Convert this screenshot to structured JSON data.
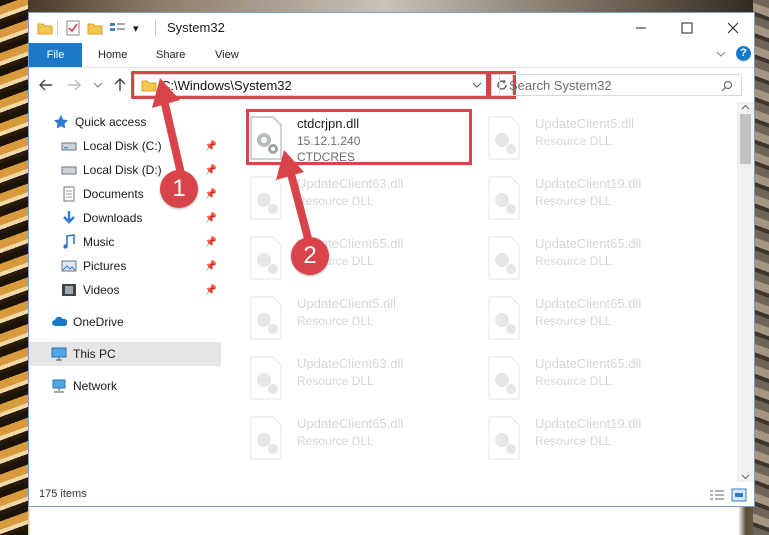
{
  "window": {
    "title": "System32",
    "qa_dropdown": "▾"
  },
  "ribbon": {
    "tabs": [
      {
        "label": "File"
      },
      {
        "label": "Home"
      },
      {
        "label": "Share"
      },
      {
        "label": "View"
      }
    ],
    "help_icon": "?"
  },
  "address": {
    "path": "C:\\Windows\\System32",
    "search_placeholder": "Search System32"
  },
  "nav": {
    "items": [
      {
        "label": "Quick access",
        "icon": "star-icon"
      },
      {
        "label": "Local Disk (C:)",
        "icon": "drive-icon"
      },
      {
        "label": "Local Disk (D:)",
        "icon": "drive-icon"
      },
      {
        "label": "Documents",
        "icon": "documents-icon"
      },
      {
        "label": "Downloads",
        "icon": "download-icon"
      },
      {
        "label": "Music",
        "icon": "music-icon"
      },
      {
        "label": "Pictures",
        "icon": "pictures-icon"
      },
      {
        "label": "Videos",
        "icon": "videos-icon"
      },
      {
        "label": "OneDrive",
        "icon": "cloud-icon"
      },
      {
        "label": "This PC",
        "icon": "pc-icon"
      },
      {
        "label": "Network",
        "icon": "network-icon"
      }
    ]
  },
  "files": {
    "highlighted": {
      "name": "ctdcrjpn.dll",
      "line2": "15.12.1.240",
      "line3": "CTDCRES"
    },
    "items": [
      {
        "name": "UpdateClient5.dll",
        "line2": "Resource DLL"
      },
      {
        "name": "UpdateClient63.dll",
        "line2": "Resource DLL"
      },
      {
        "name": "UpdateClient19.dll",
        "line2": "Resource DLL"
      },
      {
        "name": "UpdateClient65.dll",
        "line2": "Resource DLL"
      },
      {
        "name": "UpdateClient65.dll",
        "line2": "Resource DLL"
      },
      {
        "name": "UpdateClient5.dll",
        "line2": "Resource DLL"
      },
      {
        "name": "UpdateClient65.dll",
        "line2": "Resource DLL"
      },
      {
        "name": "UpdateClient63.dll",
        "line2": "Resource DLL"
      },
      {
        "name": "UpdateClient65.dll",
        "line2": "Resource DLL"
      },
      {
        "name": "UpdateClient65.dll",
        "line2": "Resource DLL"
      },
      {
        "name": "UpdateClient19.dll",
        "line2": "Resource DLL"
      }
    ]
  },
  "status": {
    "count": "175 items"
  },
  "annotations": {
    "step1": "1",
    "step2": "2"
  },
  "colors": {
    "accent": "#1979ca",
    "highlight": "#d9434a"
  }
}
